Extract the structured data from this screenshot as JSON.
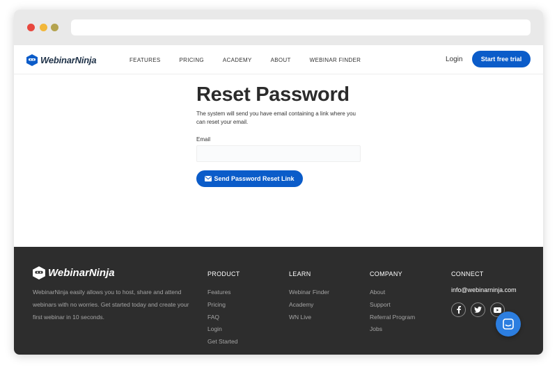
{
  "brand": {
    "name": "WebinarNinja",
    "accent": "#0b5cc9",
    "footer_bg": "#2d2d2d"
  },
  "nav": {
    "items": [
      "FEATURES",
      "PRICING",
      "ACADEMY",
      "ABOUT",
      "WEBINAR FINDER"
    ],
    "login": "Login",
    "trial": "Start free trial"
  },
  "main": {
    "title": "Reset Password",
    "description": "The system will send you have email containing a link where you can reset your email.",
    "email_label": "Email",
    "email_value": "",
    "send_button": "Send Password Reset Link"
  },
  "footer": {
    "about": "WebinarNinja easily allows you to host, share and attend webinars with no worries. Get started today and create your first webinar in 10 seconds.",
    "product": {
      "heading": "PRODUCT",
      "links": [
        "Features",
        "Pricing",
        "FAQ",
        "Login",
        "Get Started"
      ]
    },
    "learn": {
      "heading": "LEARN",
      "links": [
        "Webinar Finder",
        "Academy",
        "WN Live"
      ]
    },
    "company": {
      "heading": "COMPANY",
      "links": [
        "About",
        "Support",
        "Referral Program",
        "Jobs"
      ]
    },
    "connect": {
      "heading": "CONNECT",
      "email": "info@webinarninja.com",
      "socials": [
        "facebook-icon",
        "twitter-icon",
        "youtube-icon"
      ]
    }
  },
  "chat_widget": {
    "icon": "chat-icon"
  }
}
